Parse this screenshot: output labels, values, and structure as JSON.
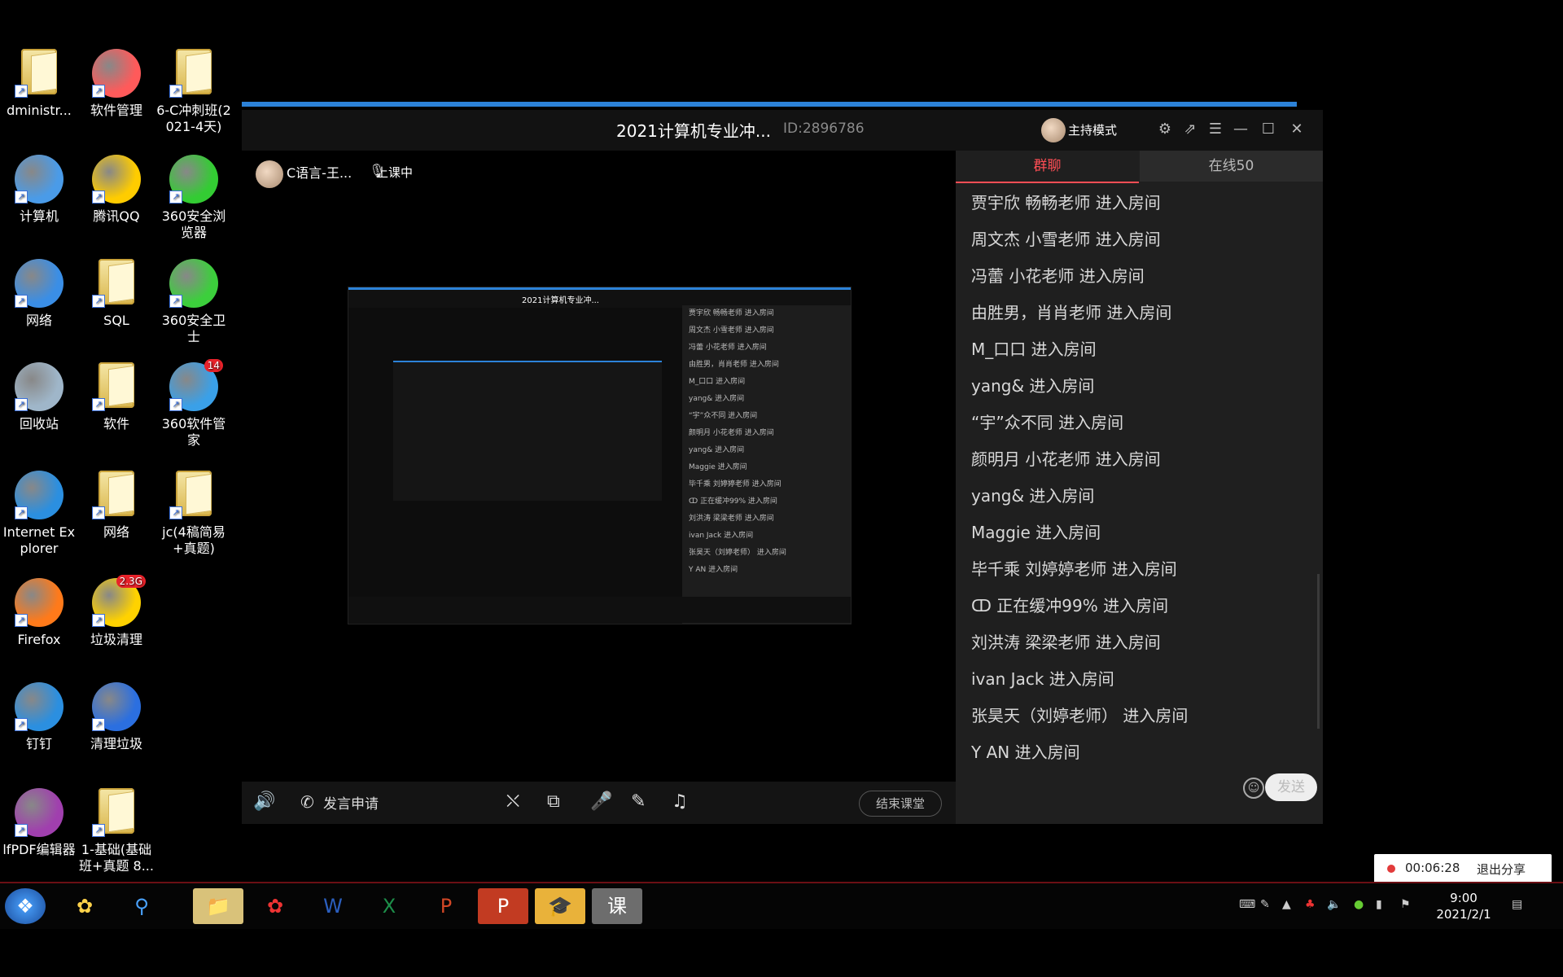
{
  "desktop": {
    "icons": [
      {
        "label": "dministr..."
      },
      {
        "label": "软件管理"
      },
      {
        "label": "6-C冲刺班(2021-4天)"
      },
      {
        "label": "计算机"
      },
      {
        "label": "腾讯QQ"
      },
      {
        "label": "360安全浏览器"
      },
      {
        "label": "网络"
      },
      {
        "label": "SQL"
      },
      {
        "label": "360安全卫士"
      },
      {
        "label": "回收站"
      },
      {
        "label": "软件"
      },
      {
        "label": "360软件管家",
        "badge": "14"
      },
      {
        "label": "Internet Explorer"
      },
      {
        "label": "网络"
      },
      {
        "label": "jc(4稿简易+真题)"
      },
      {
        "label": "Firefox"
      },
      {
        "label": "垃圾清理",
        "badge": "2.3G"
      },
      {
        "label": "钉钉"
      },
      {
        "label": "清理垃圾"
      },
      {
        "label": "lfPDF编辑器"
      },
      {
        "label": "1-基础(基础班+真题 8..."
      }
    ]
  },
  "window": {
    "title": "2021计算机专业冲...",
    "room_id": "ID:2896786",
    "host_mode": "主持模式",
    "teacher": "C语言-王...",
    "status": "上课中",
    "controls": {
      "speak_request": "发言申请",
      "end_class": "结束课堂"
    },
    "chat": {
      "tab_group": "群聊",
      "tab_online": "在线50",
      "messages": [
        "贾宇欣 畅畅老师 进入房间",
        "周文杰 小雪老师 进入房间",
        "冯蕾  小花老师 进入房间",
        "由胜男，肖肖老师 进入房间",
        "M_口口 进入房间",
        "yang& 进入房间",
        "“宇”众不同 进入房间",
        "颜明月 小花老师 进入房间",
        "yang& 进入房间",
        "Maggie 进入房间",
        "毕千乘 刘婷婷老师 进入房间",
        "ↀ 正在缓冲99% 进入房间",
        "刘洪涛 梁梁老师 进入房间",
        "ivan Jack 进入房间",
        "张昊天（刘婷老师） 进入房间",
        "Y AN 进入房间"
      ],
      "send": "发送"
    }
  },
  "recording": {
    "time": "00:06:28",
    "exit": "退出分享"
  },
  "taskbar": {
    "time": "9:00",
    "date": "2021/2/1"
  },
  "colors": {
    "accent_red": "#ff4e55",
    "title_blue": "#2c82d8"
  }
}
